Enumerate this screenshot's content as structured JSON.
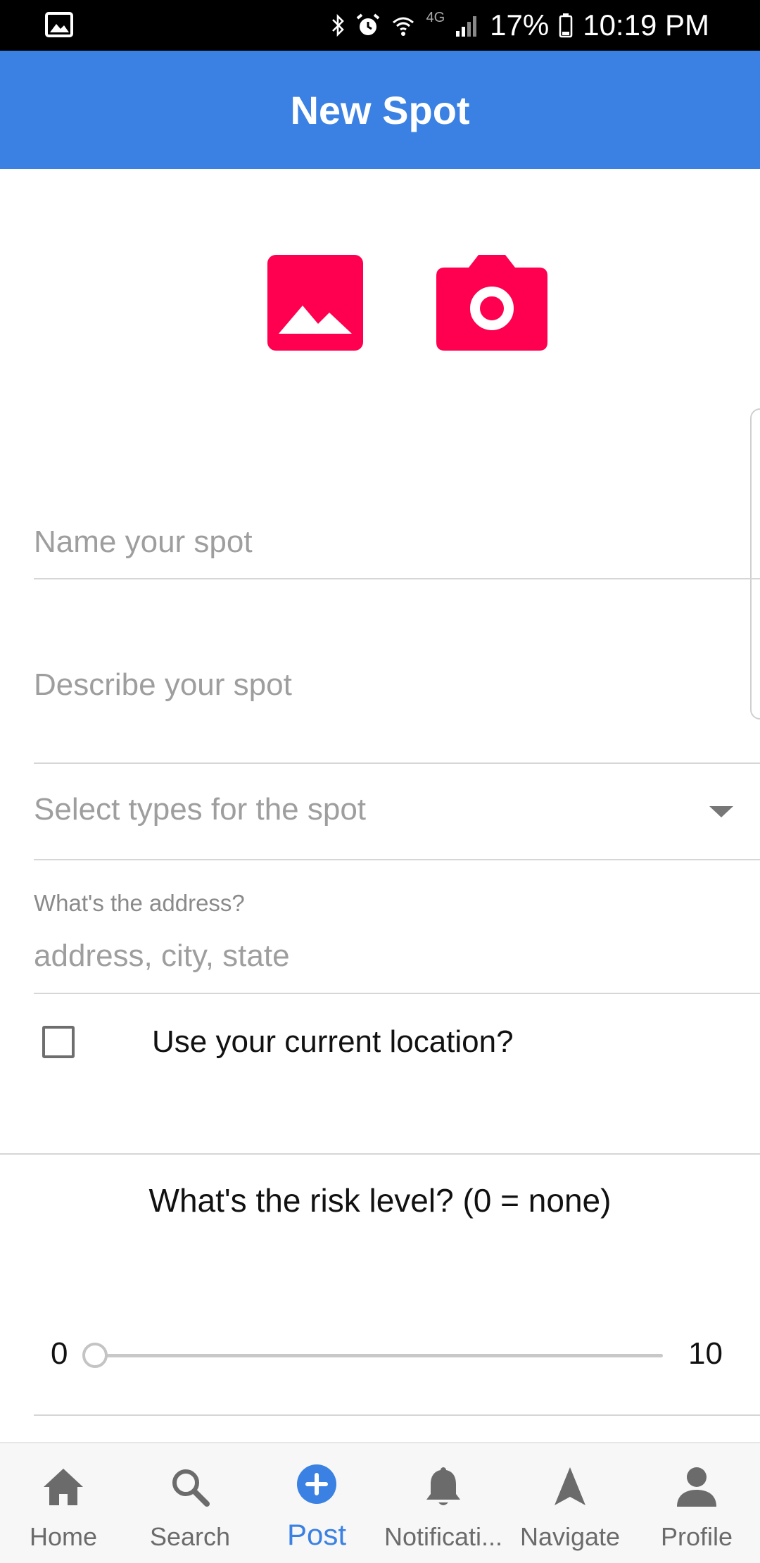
{
  "status_bar": {
    "battery": "17%",
    "time": "10:19 PM",
    "network": "4G"
  },
  "header": {
    "title": "New Spot"
  },
  "media": {
    "gallery_icon": "image-gallery-icon",
    "camera_icon": "camera-icon",
    "accent_color": "#ff0050"
  },
  "form": {
    "name": {
      "placeholder": "Name your spot",
      "value": ""
    },
    "description": {
      "placeholder": "Describe your spot",
      "value": ""
    },
    "types": {
      "placeholder": "Select types for the spot"
    },
    "address": {
      "label": "What's the address?",
      "placeholder": "address, city, state",
      "value": ""
    },
    "current_location": {
      "label": "Use your current location?",
      "checked": false
    },
    "risk": {
      "title": "What's the risk level? (0 = none)",
      "min_label": "0",
      "max_label": "10",
      "value": 0
    }
  },
  "bottom_nav": {
    "items": [
      {
        "label": "Home",
        "icon": "home-icon",
        "active": false
      },
      {
        "label": "Search",
        "icon": "search-icon",
        "active": false
      },
      {
        "label": "Post",
        "icon": "add-circle-icon",
        "active": true
      },
      {
        "label": "Notificati...",
        "icon": "bell-icon",
        "active": false
      },
      {
        "label": "Navigate",
        "icon": "navigation-arrow-icon",
        "active": false
      },
      {
        "label": "Profile",
        "icon": "person-icon",
        "active": false
      }
    ],
    "active_color": "#3a81e3",
    "inactive_color": "#6b6b6b"
  },
  "theme": {
    "primary": "#3a81e3"
  }
}
